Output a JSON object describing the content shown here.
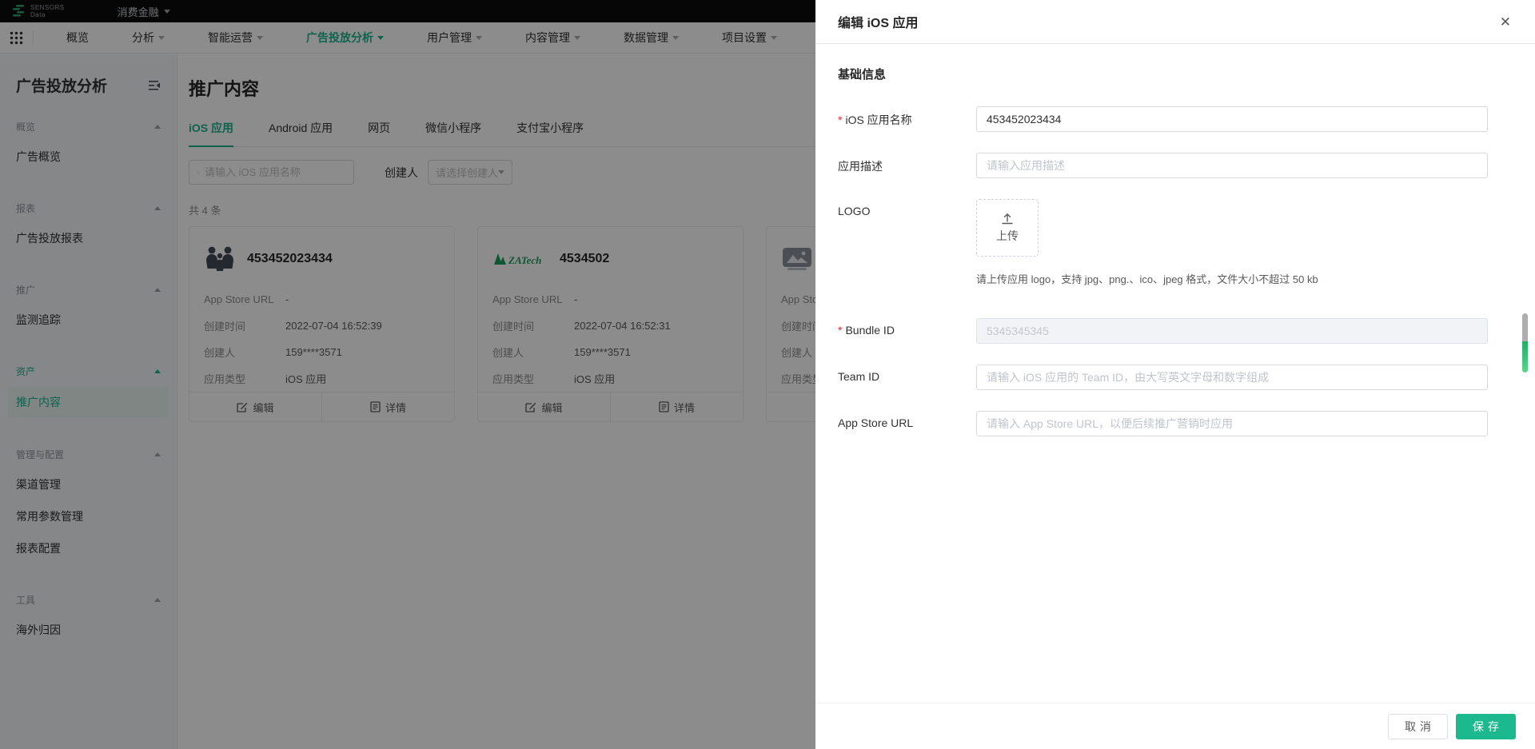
{
  "colors": {
    "accent": "#1bb38b",
    "required": "#f5222d",
    "save_button": "#1cb88e"
  },
  "topbar": {
    "brand_line1": "SENSORS",
    "brand_line2": "Data",
    "project": "消费金融"
  },
  "nav": {
    "items": [
      {
        "label": "概览"
      },
      {
        "label": "分析"
      },
      {
        "label": "智能运营"
      },
      {
        "label": "广告投放分析"
      },
      {
        "label": "用户管理"
      },
      {
        "label": "内容管理"
      },
      {
        "label": "数据管理"
      },
      {
        "label": "项目设置"
      }
    ]
  },
  "sidebar": {
    "title": "广告投放分析",
    "groups": [
      {
        "title": "概览",
        "items": [
          {
            "label": "广告概览"
          }
        ]
      },
      {
        "title": "报表",
        "items": [
          {
            "label": "广告投放报表"
          }
        ]
      },
      {
        "title": "推广",
        "items": [
          {
            "label": "监测追踪"
          }
        ]
      },
      {
        "title": "资产",
        "items": [
          {
            "label": "推广内容"
          }
        ]
      },
      {
        "title": "管理与配置",
        "items": [
          {
            "label": "渠道管理"
          },
          {
            "label": "常用参数管理"
          },
          {
            "label": "报表配置"
          }
        ]
      },
      {
        "title": "工具",
        "items": [
          {
            "label": "海外归因"
          }
        ]
      }
    ]
  },
  "main": {
    "title": "推广内容",
    "tabs": [
      {
        "label": "iOS 应用"
      },
      {
        "label": "Android 应用"
      },
      {
        "label": "网页"
      },
      {
        "label": "微信小程序"
      },
      {
        "label": "支付宝小程序"
      }
    ],
    "search_placeholder": "请输入 iOS 应用名称",
    "creator_label": "创建人",
    "creator_placeholder": "请选择创建人",
    "count_text": "共 4 条",
    "row_labels": {
      "app_store_url": "App Store URL",
      "created_at": "创建时间",
      "creator": "创建人",
      "app_type": "应用类型"
    },
    "card_actions": {
      "edit": "编辑",
      "detail": "详情"
    },
    "cards": [
      {
        "name": "453452023434",
        "app_store_url": "-",
        "created_at": "2022-07-04 16:52:39",
        "creator": "159****3571",
        "app_type": "iOS 应用"
      },
      {
        "name": "4534502",
        "app_store_url": "-",
        "created_at": "2022-07-04 16:52:31",
        "creator": "159****3571",
        "app_type": "iOS 应用"
      },
      {}
    ]
  },
  "drawer": {
    "title": "编辑 iOS 应用",
    "close_icon": "✕",
    "section_title": "基础信息",
    "required_mark": "*",
    "fields": {
      "app_name": {
        "label": "iOS 应用名称",
        "value": "453452023434"
      },
      "description": {
        "label": "应用描述",
        "placeholder": "请输入应用描述"
      },
      "logo": {
        "label": "LOGO",
        "upload_text": "上传",
        "hint": "请上传应用 logo，支持 jpg、png.、ico、jpeg 格式，文件大小不超过 50 kb"
      },
      "bundle_id": {
        "label": "Bundle ID",
        "value": "5345345345"
      },
      "team_id": {
        "label": "Team ID",
        "placeholder": "请输入 iOS 应用的 Team ID，由大写英文字母和数字组成"
      },
      "app_store_url": {
        "label": "App Store URL",
        "placeholder": "请输入 App Store URL，以便后续推广营销时应用"
      }
    },
    "cancel_label": "取消",
    "save_label": "保存"
  }
}
